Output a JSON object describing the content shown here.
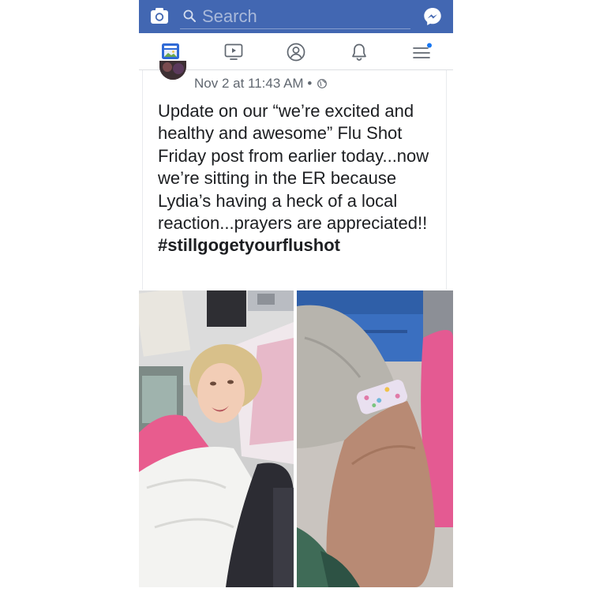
{
  "topbar": {
    "search_placeholder": "Search",
    "icons": [
      "camera-icon",
      "search-icon",
      "messenger-icon"
    ],
    "color": "#4267b2"
  },
  "tabs": [
    {
      "name": "news-feed",
      "icon": "news-feed-icon",
      "active": true
    },
    {
      "name": "watch",
      "icon": "video-icon",
      "active": false
    },
    {
      "name": "profile",
      "icon": "profile-icon",
      "active": false
    },
    {
      "name": "notifications",
      "icon": "bell-icon",
      "active": false
    },
    {
      "name": "menu",
      "icon": "menu-icon",
      "active": false,
      "badge_dot": true
    }
  ],
  "post": {
    "timestamp": "Nov 2 at 11:43 AM",
    "separator": "•",
    "privacy_icon": "globe-icon",
    "body": "Update on our “we’re excited and healthy and awesome” Flu Shot Friday post from earlier today...now we’re sitting in the ER because Lydia’s having a heck of a local reaction...prayers are appreciated!!",
    "hashtag": "#stillgogetyourflushot"
  },
  "photos": [
    {
      "name": "photo-girl-in-hospital-bed"
    },
    {
      "name": "photo-arm-with-bandage"
    }
  ],
  "colors": {
    "accent": "#4267b2",
    "notification_dot": "#1877f2",
    "meta_text": "#606770",
    "body_text": "#1c1e21"
  }
}
